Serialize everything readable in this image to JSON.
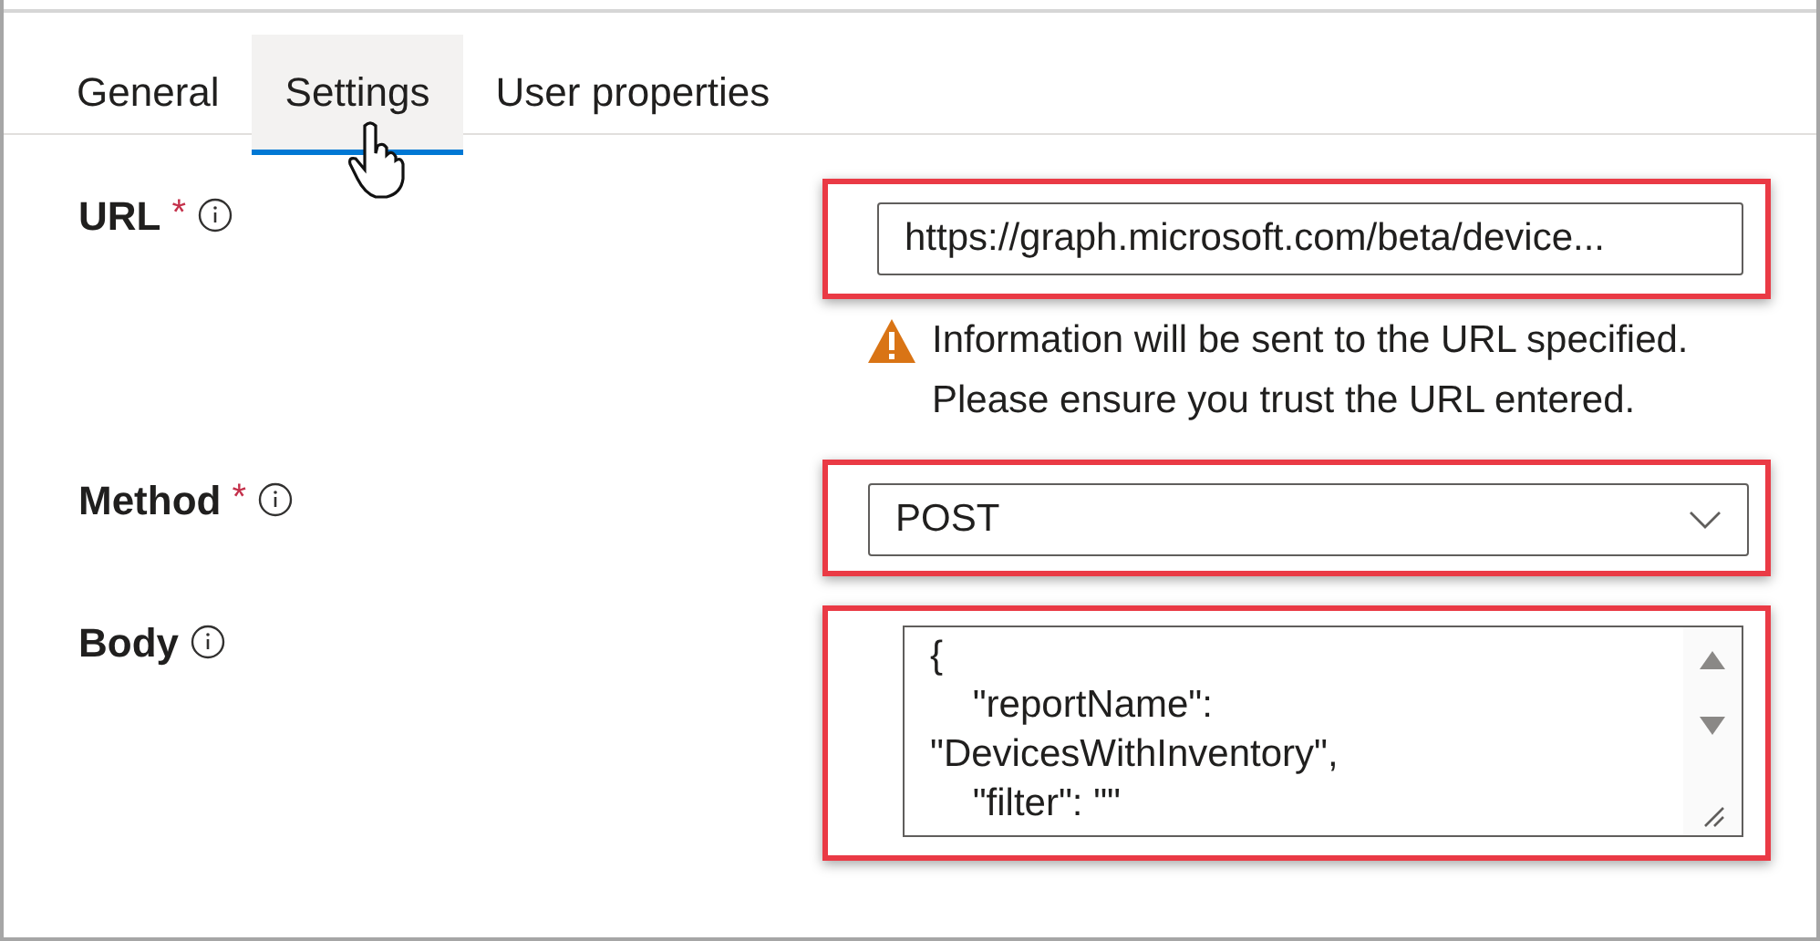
{
  "tabs": [
    {
      "label": "General",
      "selected": false
    },
    {
      "label": "Settings",
      "selected": true
    },
    {
      "label": "User properties",
      "selected": false
    }
  ],
  "fields": [
    {
      "kind": "text",
      "label": "URL",
      "required_mark": "*",
      "value": "https://graph.microsoft.com/beta/device...",
      "highlighted": true,
      "warning": "Information will be sent to the URL specified. Please ensure you trust the URL entered."
    },
    {
      "kind": "select",
      "label": "Method",
      "required_mark": "*",
      "value": "POST",
      "highlighted": true
    },
    {
      "kind": "textarea",
      "label": "Body",
      "lines": [
        "{",
        "    \"reportName\":",
        "\"DevicesWithInventory\",",
        "    \"filter\": \"\""
      ],
      "highlighted": true
    }
  ]
}
